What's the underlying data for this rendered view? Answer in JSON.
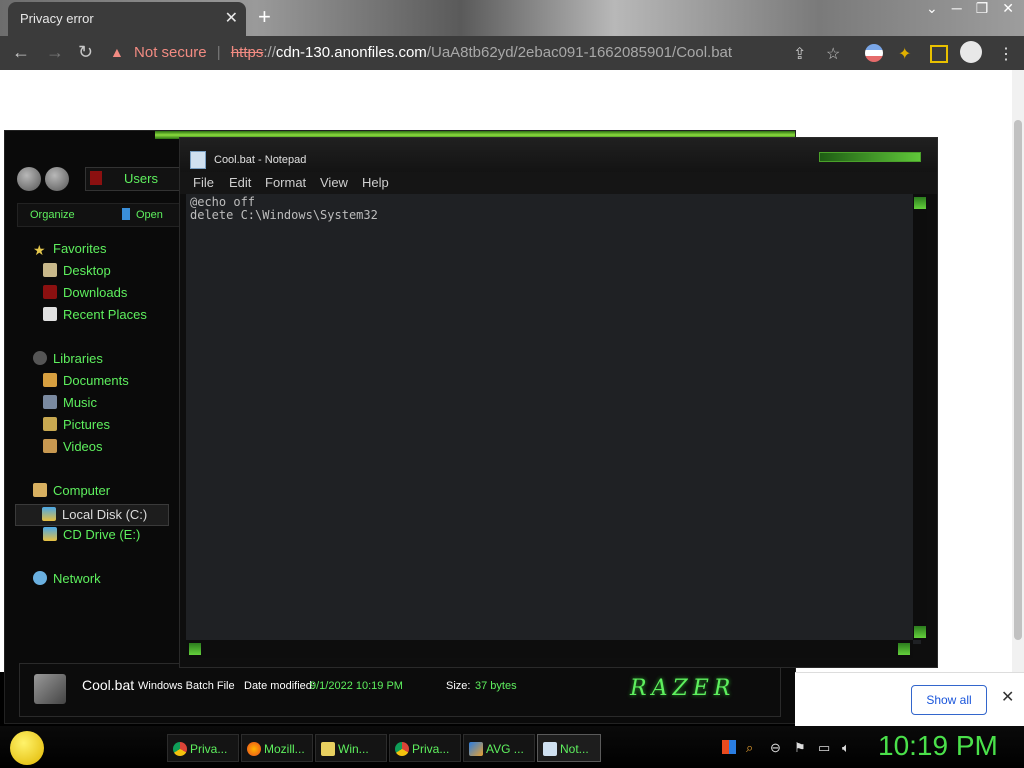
{
  "browser": {
    "tab_title": "Privacy error",
    "security_label": "Not secure",
    "url_scheme": "https",
    "url_sep": "://",
    "url_host": "cdn-130.anonfiles.com",
    "url_path": "/UaA8tb62yd/2ebac091-1662085901/Cool.bat"
  },
  "explorer": {
    "breadcrumb": "Users",
    "organize": "Organize",
    "open": "Open",
    "favorites_header": "Favorites",
    "favorites": [
      "Desktop",
      "Downloads",
      "Recent Places"
    ],
    "libraries_header": "Libraries",
    "libraries": [
      "Documents",
      "Music",
      "Pictures",
      "Videos"
    ],
    "computer_header": "Computer",
    "drives": [
      "Local Disk (C:)",
      "CD Drive (E:)"
    ],
    "network": "Network",
    "details": {
      "name": "Cool.bat",
      "type": "Windows Batch File",
      "date_label": "Date modified:",
      "date_value": "9/1/2022 10:19 PM",
      "size_label": "Size:",
      "size_value": "37 bytes"
    },
    "brand_logo": "RAZER"
  },
  "notepad": {
    "title": "Cool.bat - Notepad",
    "menu": [
      "File",
      "Edit",
      "Format",
      "View",
      "Help"
    ],
    "content_line1": "@echo off",
    "content_line2": "delete C:\\Windows\\System32"
  },
  "download_bar": {
    "show_all": "Show all"
  },
  "taskbar": {
    "items": [
      "Priva...",
      "Mozill...",
      "Win...",
      "Priva...",
      "AVG ...",
      "Not..."
    ],
    "clock": "10:19 PM"
  }
}
